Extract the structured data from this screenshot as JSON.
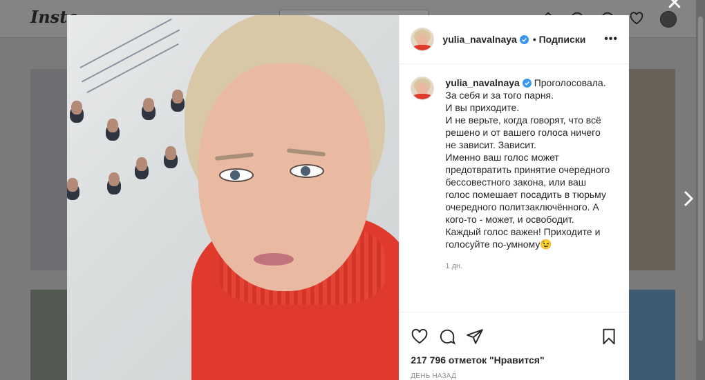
{
  "background": {
    "logo": "Insta"
  },
  "post": {
    "username": "yulia_navalnaya",
    "follow_label": "• Подписки",
    "more_label": "•••",
    "caption": "Проголосовала. За себя и за того парня.\nИ вы приходите.\nИ не верьте, когда говорят, что всё решено и от вашего голоса ничего не зависит. Зависит.\nИменно ваш голос может предотвратить принятие очередного бессовестного закона, или ваш голос помешает посадить в тюрьму очередного политзаключённого. А кого-то - может, и освободит.\nКаждый голос важен! Приходите и голосуйте по-умному😉",
    "time_ago": "1 дн.",
    "likes": "217 796 отметок \"Нравится\"",
    "posted": "ДЕНЬ НАЗАД"
  },
  "icons": {
    "header": [
      "home-icon",
      "messenger-icon",
      "explore-icon",
      "heart-icon"
    ],
    "actions": [
      "heart-icon",
      "comment-icon",
      "share-icon",
      "bookmark-icon"
    ],
    "verified": "verified-badge-icon",
    "close": "close-icon",
    "next": "chevron-right-icon"
  },
  "colors": {
    "verified": "#3897f0",
    "sweater": "#e03a2c",
    "text": "#262626",
    "muted": "#8e8e8e"
  }
}
